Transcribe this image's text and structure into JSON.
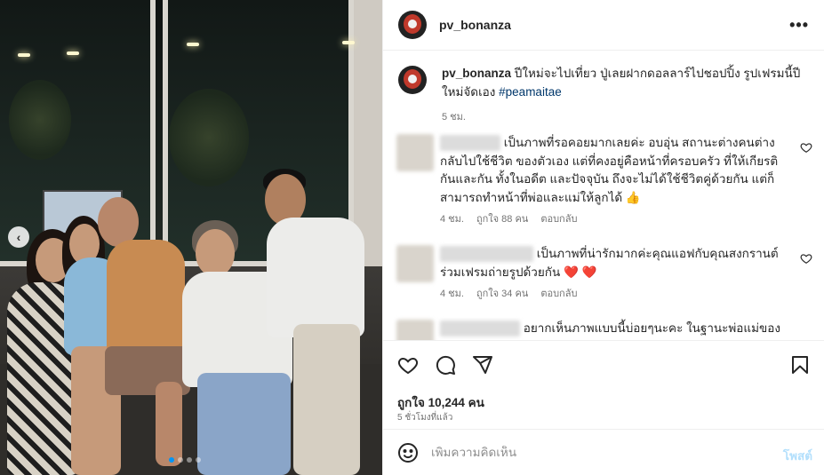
{
  "post": {
    "username": "pv_bonanza",
    "more_icon": "more-horizontal-icon"
  },
  "caption": {
    "username": "pv_bonanza",
    "text": "ปีใหม่จะไปเที่ยว ปู่เลยฝากดอลลาร์ไปชอปปิ้ง รูปเฟรมนี้ปีใหม่จัดเอง",
    "hashtag": "#peamaitae",
    "time": "5 ชม."
  },
  "comments": [
    {
      "text": "เป็นภาพที่รอคอยมากเลยค่ะ อบอุ่น สถานะต่างคนต่างกลับไปใช้ชีวิต ของตัวเอง แต่ที่คงอยู่คือหน้าที่ครอบครัว ที่ให้เกียรติกันและกัน ทั้งในอดีต และปัจจุบัน ถึงจะไม่ได้ใช้ชีวิตคู่ด้วยกัน แต่ก็สามารถทำหน้าที่พ่อและแม่ให้ลูกได้ 👍",
      "time": "4 ชม.",
      "likes": "ถูกใจ 88 คน",
      "reply": "ตอบกลับ"
    },
    {
      "text": "เป็นภาพที่น่ารักมากค่ะคุณแอฟกับคุณสงกรานต์ร่วมเฟรมถ่ายรูปด้วยกัน ❤️ ❤️",
      "time": "4 ชม.",
      "likes": "ถูกใจ 34 คน",
      "reply": "ตอบกลับ"
    },
    {
      "text": "อยากเห็นภาพแบบนี้บ่อยๆนะคะ ในฐานะพ่อแม่ของ",
      "time": "",
      "likes": "",
      "reply": ""
    }
  ],
  "actions": {
    "like_icon": "heart-icon",
    "comment_icon": "comment-icon",
    "share_icon": "send-icon",
    "save_icon": "bookmark-icon",
    "likes": "ถูกใจ 10,244 คน",
    "time_ago": "5 ชั่วโมงที่แล้ว"
  },
  "composer": {
    "emoji_icon": "smiley-icon",
    "placeholder": "เพิ่มความคิดเห็น",
    "post_label": "โพสต์"
  },
  "media": {
    "prev_icon": "chevron-left-icon",
    "slide_count": 4,
    "active_slide": 1
  },
  "colors": {
    "link": "#00376b",
    "accent": "#0095f6",
    "post_button_disabled": "#b2dffc",
    "heart_red": "#ed4956"
  }
}
